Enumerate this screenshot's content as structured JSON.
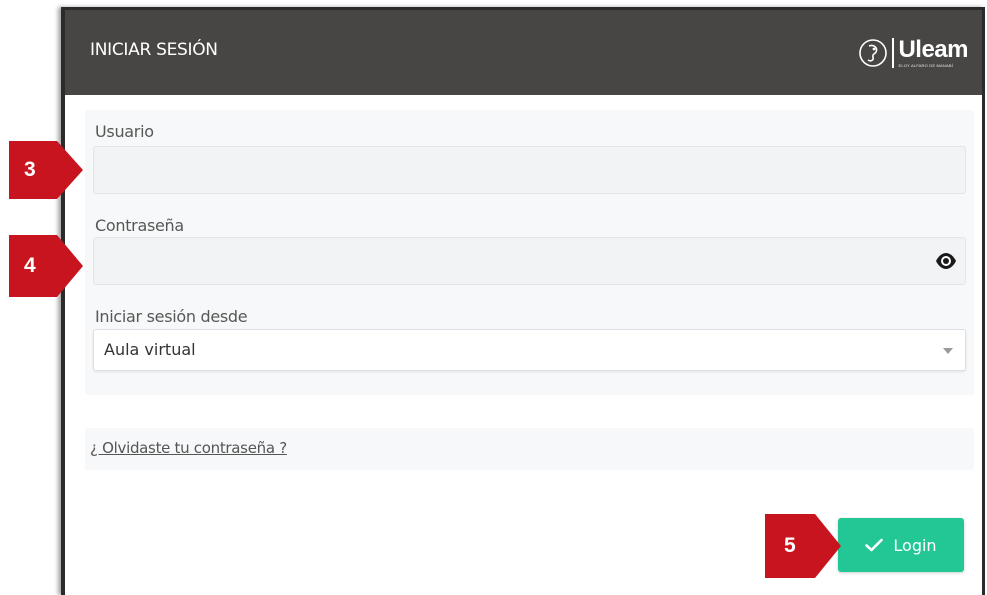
{
  "modal": {
    "title": "INICIAR SESIÓN",
    "logo": {
      "wordmark": "Uleam",
      "subtitle": "ELOY ALFARO DE MANABÍ",
      "icon": "university-emblem-icon"
    }
  },
  "form": {
    "username": {
      "label": "Usuario",
      "value": "",
      "placeholder": ""
    },
    "password": {
      "label": "Contraseña",
      "value": "",
      "placeholder": "",
      "toggle_icon": "eye-icon"
    },
    "login_from": {
      "label": "Iniciar sesión desde",
      "selected": "Aula virtual"
    }
  },
  "forgot_password": {
    "label": "¿ Olvidaste tu contraseña ?"
  },
  "login_button": {
    "label": "Login",
    "icon": "check-icon",
    "color": "#22c795"
  },
  "callouts": [
    {
      "number": "3",
      "target": "username-input"
    },
    {
      "number": "4",
      "target": "password-input"
    },
    {
      "number": "5",
      "target": "login-button"
    }
  ],
  "colors": {
    "header": "#474644",
    "callout": "#c8141e",
    "accent": "#22c795"
  }
}
